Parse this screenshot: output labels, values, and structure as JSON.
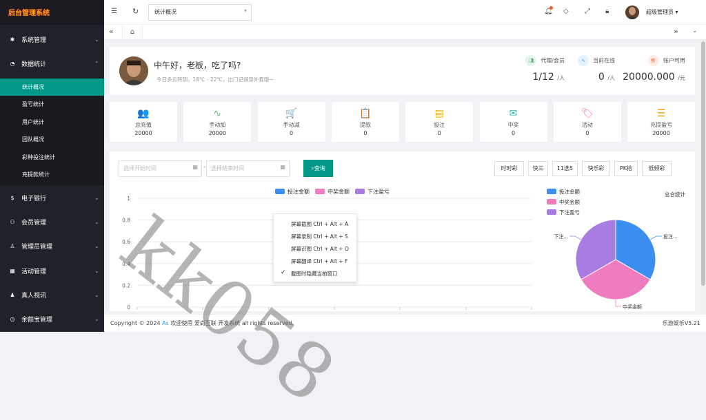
{
  "app": {
    "logo_text": "后台管理系统"
  },
  "sidebar": {
    "items": [
      {
        "icon": "gear-icon",
        "label": "系统管理"
      },
      {
        "icon": "dashboard-icon",
        "label": "数据统计"
      },
      {
        "icon": "coin-icon",
        "label": "电子银行"
      },
      {
        "icon": "users-icon",
        "label": "会员管理"
      },
      {
        "icon": "user-icon",
        "label": "管理员管理"
      },
      {
        "icon": "gift-icon",
        "label": "活动管理"
      },
      {
        "icon": "person-video-icon",
        "label": "真人视讯"
      },
      {
        "icon": "clock-icon",
        "label": "余额宝管理"
      }
    ],
    "sub_items": [
      "统计概况",
      "盈亏统计",
      "用户统计",
      "团队概况",
      "彩种投注统计",
      "充提款统计"
    ]
  },
  "header": {
    "page_select": "统计概况",
    "username": "超级管理员"
  },
  "welcome": {
    "greeting": "中午好，老板，吃了吗?",
    "subtitle": "今日多云转阴，18℃ - 22℃，出门记得穿外套哦~"
  },
  "stats": [
    {
      "label": "代理/会员",
      "value": "1/12",
      "unit": "/人",
      "color": "#5fb878"
    },
    {
      "label": "当前在线",
      "value": "0",
      "unit": "/人",
      "color": "#1e9fff"
    },
    {
      "label": "账户可用",
      "value": "20000.000",
      "unit": "/元",
      "color": "#ff5722"
    }
  ],
  "quick": [
    {
      "label": "总充值",
      "value": "20000",
      "icon": "users-icon",
      "color": "#1e9fff",
      "glyph": "👥"
    },
    {
      "label": "手动加",
      "value": "20000",
      "icon": "pulse-icon",
      "color": "#5fb878",
      "glyph": "∿"
    },
    {
      "label": "手动减",
      "value": "0",
      "icon": "cart-icon",
      "color": "#ff9800",
      "glyph": "🛒"
    },
    {
      "label": "提款",
      "value": "0",
      "icon": "clipboard-icon",
      "color": "#a77cd8",
      "glyph": "📋"
    },
    {
      "label": "投注",
      "value": "0",
      "icon": "card-icon",
      "color": "#f5b800",
      "glyph": "▤"
    },
    {
      "label": "中奖",
      "value": "0",
      "icon": "mail-icon",
      "color": "#2db7a3",
      "glyph": "✉"
    },
    {
      "label": "活动",
      "value": "0",
      "icon": "tag-icon",
      "color": "#ff6b8a",
      "glyph": "🏷"
    },
    {
      "label": "充提盈亏",
      "value": "20000",
      "icon": "sliders-icon",
      "color": "#ff9800",
      "glyph": "☰"
    }
  ],
  "filter": {
    "start_placeholder": "选择开始时间",
    "end_placeholder": "选择结束时间",
    "query_label": "查询",
    "lotteries": [
      "时时彩",
      "快三",
      "11选5",
      "快乐彩",
      "PK拾",
      "低频彩"
    ]
  },
  "context_menu": {
    "items": [
      "屏幕截图 Ctrl + Alt + A",
      "屏幕录制 Ctrl + Alt + S",
      "屏幕识图 Ctrl + Alt + O",
      "屏幕翻译 Ctrl + Alt + F",
      "截图时隐藏当前窗口"
    ]
  },
  "chart_data": [
    {
      "type": "bar",
      "legend_position": "top",
      "series": [
        {
          "name": "投注金额",
          "values": [],
          "color": "#3c8ff0"
        },
        {
          "name": "中奖金额",
          "values": [],
          "color": "#f07cc0"
        },
        {
          "name": "下注盈亏",
          "values": [],
          "color": "#a87ce0"
        }
      ],
      "ylim": [
        0,
        1
      ],
      "yticks": [
        "0",
        "0.2",
        "0.4",
        "0.6",
        "0.8",
        "1"
      ],
      "grid": true
    },
    {
      "type": "pie",
      "title": "总合统计",
      "legend_position": "top-left",
      "slices": [
        {
          "name": "投注金额",
          "value": 1,
          "color": "#3c8ff0",
          "label": "投注..."
        },
        {
          "name": "中奖金额",
          "value": 1,
          "color": "#f07cc0",
          "label": "中奖金额"
        },
        {
          "name": "下注盈亏",
          "value": 1,
          "color": "#a87ce0",
          "label": "下注..."
        }
      ]
    }
  ],
  "footer": {
    "copyright_prefix": "Copyright © 2024 ",
    "as": "As",
    "copyright_suffix": " 欢迎使用 爱尚互联 开发系统 all rights reserved.",
    "version": "乐游娱乐V5.21"
  },
  "watermark": "kk058"
}
